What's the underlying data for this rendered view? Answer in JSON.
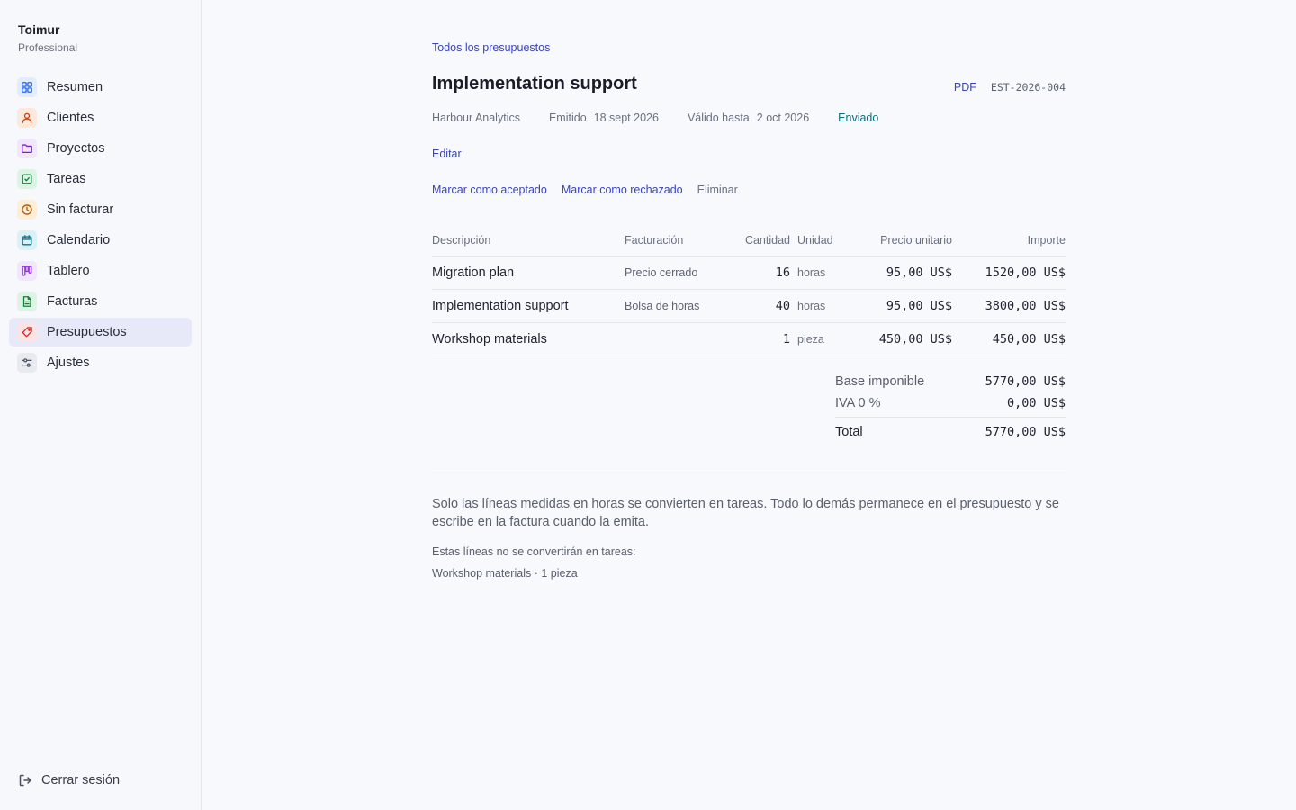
{
  "sidebar": {
    "brand": "Toimur",
    "plan": "Professional",
    "items": [
      {
        "label": "Resumen",
        "icon": "grid-icon",
        "color": "#2563eb",
        "bg": "#e3ecfd"
      },
      {
        "label": "Clientes",
        "icon": "person-icon",
        "color": "#c2410c",
        "bg": "#fde9dc"
      },
      {
        "label": "Proyectos",
        "icon": "folder-icon",
        "color": "#7e22ce",
        "bg": "#f1e6fb"
      },
      {
        "label": "Tareas",
        "icon": "checkbox-icon",
        "color": "#15803d",
        "bg": "#ddf3e4"
      },
      {
        "label": "Sin facturar",
        "icon": "clock-icon",
        "color": "#b45309",
        "bg": "#fcefd6"
      },
      {
        "label": "Calendario",
        "icon": "calendar-icon",
        "color": "#0e7490",
        "bg": "#dcf1f5"
      },
      {
        "label": "Tablero",
        "icon": "kanban-icon",
        "color": "#9333ea",
        "bg": "#f1e6fb"
      },
      {
        "label": "Facturas",
        "icon": "document-icon",
        "color": "#15803d",
        "bg": "#ddf3e4"
      },
      {
        "label": "Presupuestos",
        "icon": "tag-icon",
        "color": "#dc2626",
        "bg": "#fde4e4"
      },
      {
        "label": "Ajustes",
        "icon": "sliders-icon",
        "color": "#4b5563",
        "bg": "#e8eaef"
      }
    ],
    "active_index": 8,
    "logout": "Cerrar sesión"
  },
  "estimate": {
    "breadcrumb": "Todos los presupuestos",
    "title": "Implementation support",
    "pdf": "PDF",
    "id": "EST-2026-004",
    "client": "Harbour Analytics",
    "issued_label": "Emitido",
    "issued_date": "18 sept 2026",
    "valid_label": "Válido hasta",
    "valid_date": "2 oct 2026",
    "status": "Enviado",
    "edit": "Editar",
    "actions": {
      "accept": "Marcar como aceptado",
      "reject": "Marcar como rechazado",
      "delete": "Eliminar"
    }
  },
  "table": {
    "headers": {
      "description": "Descripción",
      "billing": "Facturación",
      "quantity": "Cantidad",
      "unit": "Unidad",
      "unit_price": "Precio unitario",
      "amount": "Importe"
    },
    "rows": [
      {
        "description": "Migration plan",
        "billing": "Precio cerrado",
        "quantity": "16",
        "unit": "horas",
        "unit_price": "95,00 US$",
        "amount": "1520,00 US$"
      },
      {
        "description": "Implementation support",
        "billing": "Bolsa de horas",
        "quantity": "40",
        "unit": "horas",
        "unit_price": "95,00 US$",
        "amount": "3800,00 US$"
      },
      {
        "description": "Workshop materials",
        "billing": "",
        "quantity": "1",
        "unit": "pieza",
        "unit_price": "450,00 US$",
        "amount": "450,00 US$"
      }
    ]
  },
  "totals": {
    "subtotal_label": "Base imponible",
    "subtotal": "5770,00 US$",
    "tax_label": "IVA 0 %",
    "tax": "0,00 US$",
    "total_label": "Total",
    "total": "5770,00 US$"
  },
  "notes": {
    "main": "Solo las líneas medidas en horas se convierten en tareas. Todo lo demás permanece en el presupuesto y se escribe en la factura cuando la emita.",
    "not_converted_label": "Estas líneas no se convertirán en tareas:",
    "not_converted_items": "Workshop materials · 1 pieza"
  }
}
